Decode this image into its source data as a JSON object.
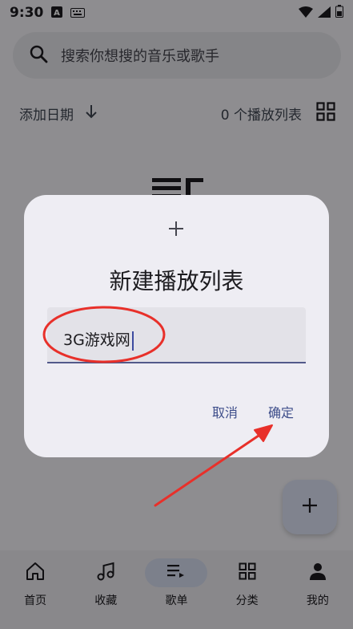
{
  "status_bar": {
    "time": "9:30"
  },
  "search": {
    "placeholder": "搜索你想搜的音乐或歌手"
  },
  "list_header": {
    "sort_label": "添加日期",
    "playlist_count": "0 个播放列表"
  },
  "bottom_nav": {
    "items": [
      {
        "label": "首页",
        "icon": "home-icon"
      },
      {
        "label": "收藏",
        "icon": "music-note-icon"
      },
      {
        "label": "歌单",
        "icon": "playlist-icon",
        "active": true
      },
      {
        "label": "分类",
        "icon": "grid-icon"
      },
      {
        "label": "我的",
        "icon": "person-icon"
      }
    ]
  },
  "dialog": {
    "title": "新建播放列表",
    "input_value": "3G游戏网",
    "cancel_label": "取消",
    "confirm_label": "确定"
  },
  "colors": {
    "accent": "#3d4d8a",
    "annotation": "#e8302a",
    "scrim": "#000000"
  }
}
